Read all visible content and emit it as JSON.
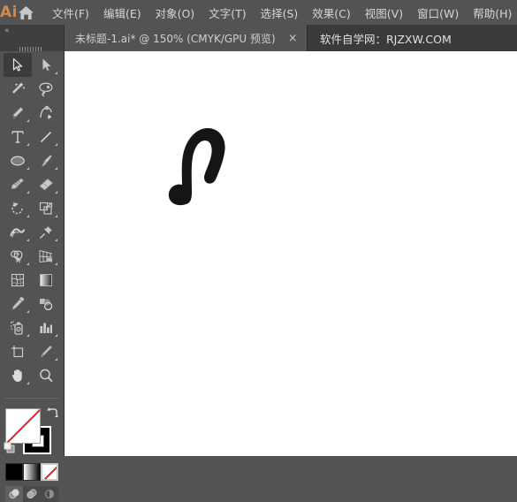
{
  "app": {
    "name": "Ai",
    "logo_color": "#d4884a",
    "home_icon": "home-icon"
  },
  "menubar": {
    "items": [
      {
        "label": "文件(F)",
        "name": "menu-file"
      },
      {
        "label": "编辑(E)",
        "name": "menu-edit"
      },
      {
        "label": "对象(O)",
        "name": "menu-object"
      },
      {
        "label": "文字(T)",
        "name": "menu-type"
      },
      {
        "label": "选择(S)",
        "name": "menu-select"
      },
      {
        "label": "效果(C)",
        "name": "menu-effect"
      },
      {
        "label": "视图(V)",
        "name": "menu-view"
      },
      {
        "label": "窗口(W)",
        "name": "menu-window"
      },
      {
        "label": "帮助(H)",
        "name": "menu-help"
      }
    ]
  },
  "tabbar": {
    "document_tab": {
      "title": "未标题-1.ai* @ 150% (CMYK/GPU 预览)",
      "close_label": "×",
      "file_name": "未标题-1.ai",
      "modified": "*",
      "zoom": "150%",
      "color_mode": "CMYK",
      "render_mode": "GPU 预览"
    },
    "watermark": "软件自学网：RJZXW.COM"
  },
  "left_panel": {
    "collapse_label": "«",
    "grip": "tool-grip"
  },
  "toolbar": {
    "tools": [
      {
        "name": "selection-tool",
        "label": "选择工具",
        "active": true,
        "has_flyout": false
      },
      {
        "name": "direct-selection-tool",
        "label": "直接选择工具",
        "active": false,
        "has_flyout": true
      },
      {
        "name": "magic-wand-tool",
        "label": "魔棒工具",
        "active": false,
        "has_flyout": false
      },
      {
        "name": "lasso-tool",
        "label": "套索工具",
        "active": false,
        "has_flyout": false
      },
      {
        "name": "pen-tool",
        "label": "钢笔工具",
        "active": false,
        "has_flyout": true
      },
      {
        "name": "curvature-tool",
        "label": "曲率工具",
        "active": false,
        "has_flyout": false
      },
      {
        "name": "type-tool",
        "label": "文字工具",
        "active": false,
        "has_flyout": true
      },
      {
        "name": "line-segment-tool",
        "label": "直线段工具",
        "active": false,
        "has_flyout": true
      },
      {
        "name": "ellipse-tool",
        "label": "椭圆工具",
        "active": false,
        "has_flyout": true
      },
      {
        "name": "paintbrush-tool",
        "label": "画笔工具",
        "active": false,
        "has_flyout": true
      },
      {
        "name": "shaper-pencil-tool",
        "label": "铅笔工具",
        "active": false,
        "has_flyout": true
      },
      {
        "name": "eraser-tool",
        "label": "橡皮擦工具",
        "active": false,
        "has_flyout": true
      },
      {
        "name": "rotate-tool",
        "label": "旋转工具",
        "active": false,
        "has_flyout": true
      },
      {
        "name": "scale-tool",
        "label": "比例缩放工具",
        "active": false,
        "has_flyout": true
      },
      {
        "name": "width-warp-tool",
        "label": "宽度工具",
        "active": false,
        "has_flyout": true
      },
      {
        "name": "free-transform-tool",
        "label": "自由变换工具",
        "active": false,
        "has_flyout": true
      },
      {
        "name": "shape-builder-tool",
        "label": "形状生成器工具",
        "active": false,
        "has_flyout": true
      },
      {
        "name": "perspective-grid-tool",
        "label": "透视网格工具",
        "active": false,
        "has_flyout": true
      },
      {
        "name": "mesh-tool",
        "label": "网格工具",
        "active": false,
        "has_flyout": false
      },
      {
        "name": "gradient-tool",
        "label": "渐变工具",
        "active": false,
        "has_flyout": false
      },
      {
        "name": "eyedropper-tool",
        "label": "吸管工具",
        "active": false,
        "has_flyout": true
      },
      {
        "name": "blend-tool",
        "label": "混合工具",
        "active": false,
        "has_flyout": false
      },
      {
        "name": "symbol-sprayer-tool",
        "label": "符号喷枪工具",
        "active": false,
        "has_flyout": true
      },
      {
        "name": "column-graph-tool",
        "label": "柱形图工具",
        "active": false,
        "has_flyout": true
      },
      {
        "name": "artboard-tool",
        "label": "画板工具",
        "active": false,
        "has_flyout": false
      },
      {
        "name": "slice-tool",
        "label": "切片工具",
        "active": false,
        "has_flyout": true
      },
      {
        "name": "hand-tool",
        "label": "抓手工具",
        "active": false,
        "has_flyout": true
      },
      {
        "name": "zoom-tool",
        "label": "缩放工具",
        "active": false,
        "has_flyout": false
      }
    ],
    "fill": {
      "name": "fill-swatch",
      "value": "none",
      "color": "#ffffff",
      "none_slash_color": "#e02020"
    },
    "stroke": {
      "name": "stroke-swatch",
      "value": "black",
      "color": "#000000"
    },
    "swap_icon": "swap-fill-stroke-icon",
    "default_icon": "default-fill-stroke-icon",
    "color_modes": [
      {
        "name": "color-mode-color",
        "label": "颜色",
        "selected": false,
        "swatch": "#000000"
      },
      {
        "name": "color-mode-gradient",
        "label": "渐变",
        "selected": false,
        "swatch": "gradient"
      },
      {
        "name": "color-mode-none",
        "label": "无",
        "selected": true,
        "swatch": "none"
      }
    ],
    "draw_modes": [
      {
        "name": "draw-normal-mode",
        "label": "正常绘图",
        "active": true
      },
      {
        "name": "draw-behind-mode",
        "label": "背面绘图",
        "active": false
      },
      {
        "name": "draw-inside-mode",
        "label": "内部绘图",
        "active": false
      }
    ]
  },
  "canvas": {
    "background": "#ffffff",
    "artwork": {
      "name": "blob-brush-hook-path",
      "fill": "#151515",
      "description": "黑色钩形画笔路径"
    }
  }
}
